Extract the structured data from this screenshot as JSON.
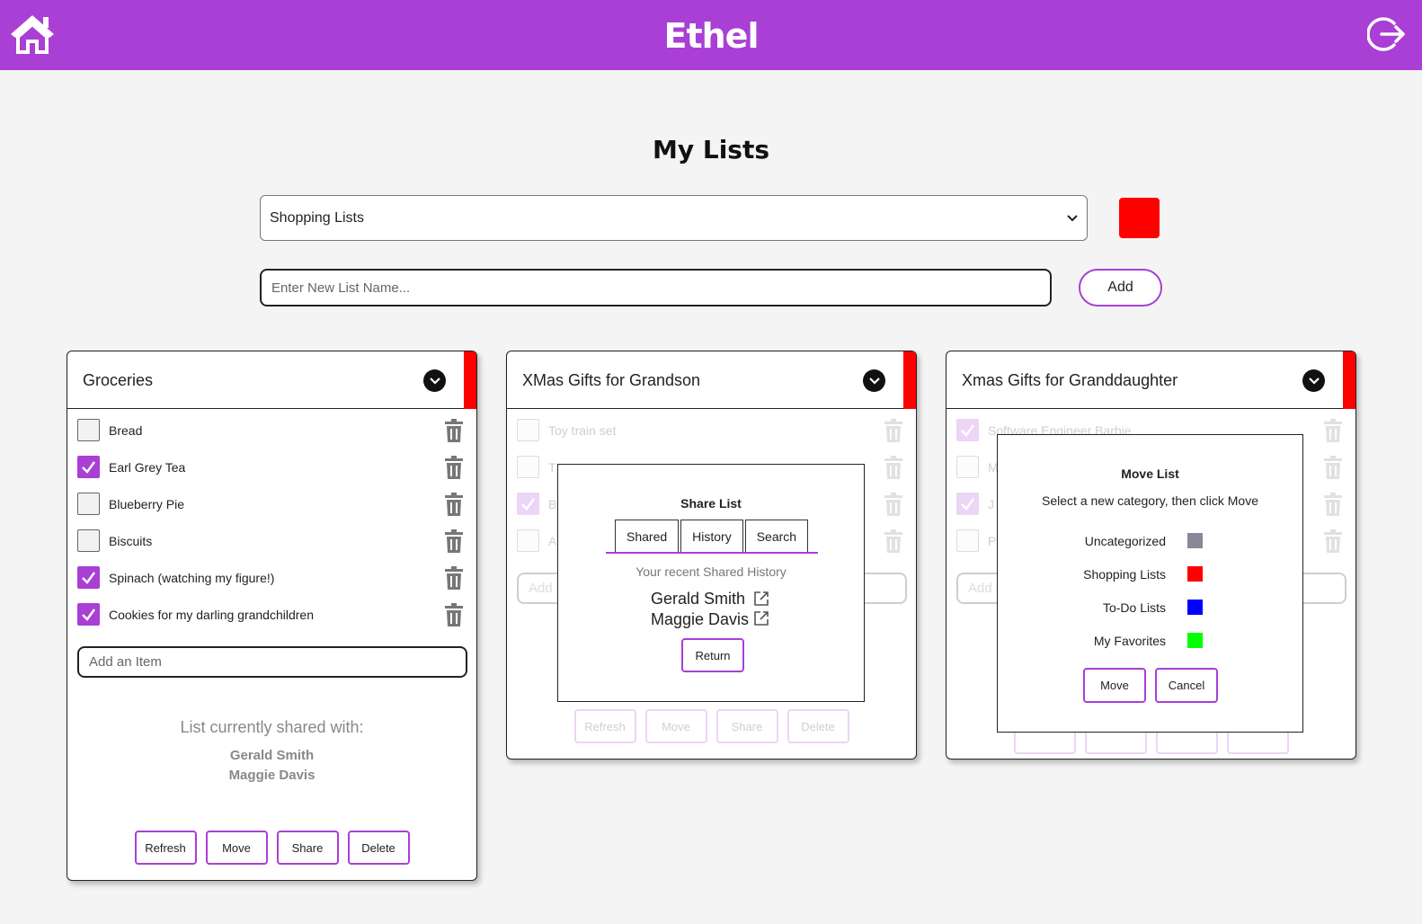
{
  "app": {
    "title": "Ethel"
  },
  "page": {
    "title": "My Lists"
  },
  "category_select": {
    "value": "Shopping Lists",
    "color": "#ff0000"
  },
  "new_list": {
    "placeholder": "Enter New List Name...",
    "add_label": "Add"
  },
  "accent_color": "#a93fd4",
  "lists": [
    {
      "name": "Groceries",
      "color": "#ff0000",
      "items": [
        {
          "label": "Bread",
          "checked": false
        },
        {
          "label": "Earl Grey Tea",
          "checked": true
        },
        {
          "label": "Blueberry Pie",
          "checked": false
        },
        {
          "label": "Biscuits",
          "checked": false
        },
        {
          "label": "Spinach (watching my figure!)",
          "checked": true
        },
        {
          "label": "Cookies for my darling grandchildren",
          "checked": true
        }
      ],
      "add_item_placeholder": "Add an Item",
      "shared_caption": "List currently shared with:",
      "shared_with": [
        "Gerald Smith",
        "Maggie Davis"
      ],
      "buttons": [
        "Refresh",
        "Move",
        "Share",
        "Delete"
      ]
    },
    {
      "name": "XMas Gifts for Grandson",
      "color": "#ff0000",
      "items": [
        {
          "label": "Toy train set",
          "checked": false
        },
        {
          "label": "T",
          "checked": false
        },
        {
          "label": "B",
          "checked": true
        },
        {
          "label": "A",
          "checked": false
        }
      ],
      "add_item_placeholder": "Add a",
      "buttons": [
        "Refresh",
        "Move",
        "Share",
        "Delete"
      ]
    },
    {
      "name": "Xmas Gifts for Granddaughter",
      "color": "#ff0000",
      "items": [
        {
          "label": "Software Engineer Barbie",
          "checked": true
        },
        {
          "label": "M",
          "checked": false
        },
        {
          "label": "J",
          "checked": true
        },
        {
          "label": "Pl",
          "checked": false
        }
      ],
      "add_item_placeholder": "Add a"
    }
  ],
  "share_modal": {
    "title": "Share List",
    "tabs": [
      "Shared",
      "History",
      "Search"
    ],
    "caption": "Your recent Shared History",
    "history": [
      "Gerald Smith",
      "Maggie Davis"
    ],
    "return_label": "Return"
  },
  "move_modal": {
    "title": "Move List",
    "subtitle": "Select a new category, then click Move",
    "categories": [
      {
        "label": "Uncategorized",
        "color": "#888899"
      },
      {
        "label": "Shopping Lists",
        "color": "#ff0000"
      },
      {
        "label": "To-Do Lists",
        "color": "#0000ff"
      },
      {
        "label": "My Favorites",
        "color": "#00ff00"
      }
    ],
    "move_label": "Move",
    "cancel_label": "Cancel"
  }
}
